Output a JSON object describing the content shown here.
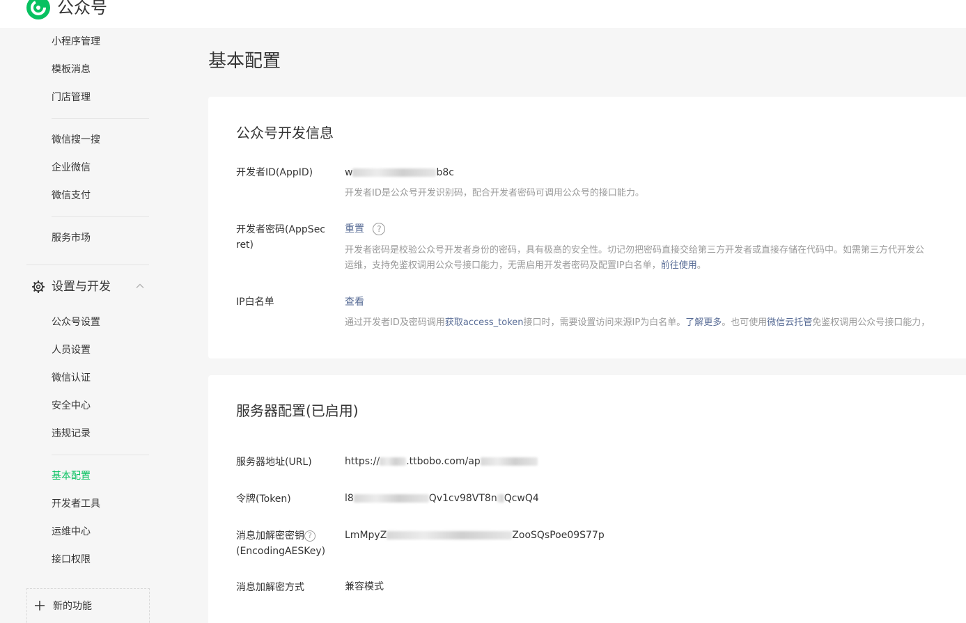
{
  "header": {
    "brand_name": "公众号"
  },
  "sidebar": {
    "items_top": [
      "小程序管理",
      "模板消息",
      "门店管理"
    ],
    "items_mid": [
      "微信搜一搜",
      "企业微信",
      "微信支付"
    ],
    "items_market": [
      "服务市场"
    ],
    "group": {
      "label": "设置与开发",
      "expanded": true
    },
    "group_items_a": [
      "公众号设置",
      "人员设置",
      "微信认证",
      "安全中心",
      "违规记录"
    ],
    "group_items_b": [
      "基本配置",
      "开发者工具",
      "运维中心",
      "接口权限"
    ],
    "active_item": "基本配置",
    "new_feature_label": "新的功能"
  },
  "page": {
    "title": "基本配置"
  },
  "dev_info": {
    "title": "公众号开发信息",
    "appid": {
      "label": "开发者ID(AppID)",
      "value_start": "w",
      "value_end": "b8c",
      "desc": "开发者ID是公众号开发识别码，配合开发者密码可调用公众号的接口能力。"
    },
    "appsecret": {
      "label_line1": "开发者密码(AppSec",
      "label_line2": "ret)",
      "reset_link": "重置",
      "help_icon": "?",
      "desc_line1": "开发者密码是校验公众号开发者身份的密码，具有极高的安全性。切记勿把密码直接交给第三方开发者或直接存储在代码中。如需第三方代开发公",
      "desc_line2_text": "运维，支持免鉴权调用公众号接口能力，无需启用开发者密码及配置IP白名单，",
      "desc_line2_link": "前往使用",
      "desc_line2_end": "。"
    },
    "ip_whitelist": {
      "label": "IP白名单",
      "view_link": "查看",
      "desc_part1": "通过开发者ID及密码调用",
      "desc_link1": "获取access_token",
      "desc_part2": "接口时，需要设置访问来源IP为白名单。",
      "desc_link2": "了解更多",
      "desc_part3": "。也可使用",
      "desc_link3": "微信云托管",
      "desc_part4": "免鉴权调用公众号接口能力，"
    }
  },
  "server_config": {
    "title": "服务器配置(已启用)",
    "url": {
      "label": "服务器地址(URL)",
      "value_start": "https://",
      "value_mid": ".ttbobo.com/ap"
    },
    "token": {
      "label": "令牌(Token)",
      "value_start": "l8",
      "value_end": "Qv1cv98VT8n",
      "value_tail": "QcwQ4"
    },
    "aeskey": {
      "label_line1": "消息加解密密钥",
      "label_line2": "(EncodingAESKey)",
      "help_icon": "?",
      "value_start": "LmMpyZ",
      "value_end": "oSQsPoe09S77p",
      "value_mid_tail": "Zo"
    },
    "encrypt_mode": {
      "label": "消息加解密方式",
      "value": "兼容模式"
    }
  },
  "colors": {
    "accent": "#07c160",
    "link": "#576b95",
    "muted": "#9a9a9a"
  }
}
